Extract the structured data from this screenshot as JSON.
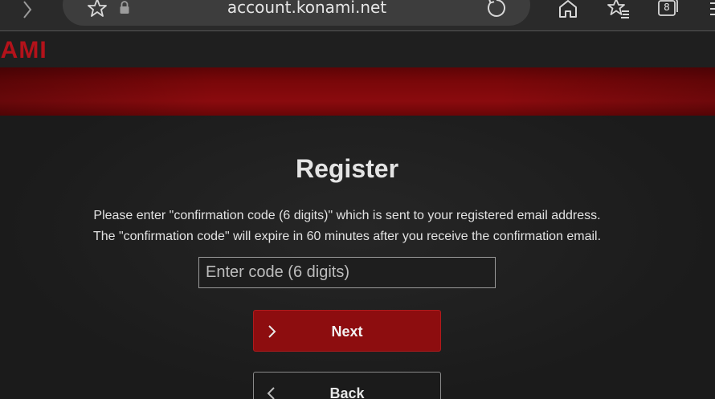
{
  "browser": {
    "url": "account.konami.net",
    "tab_count": "8",
    "icons": [
      "forward-icon",
      "star-icon",
      "lock-icon",
      "reload-icon",
      "home-icon",
      "favorites-icon",
      "tabs-icon",
      "menu-icon"
    ]
  },
  "site": {
    "logo_text": "NAMI",
    "brand_color": "#b3121a",
    "band_color": "#7a0709"
  },
  "main": {
    "title": "Register",
    "instruction_line1": "Please enter \"confirmation code (6 digits)\" which is sent to your registered email address.",
    "instruction_line2": "The \"confirmation code\" will expire in 60 minutes after you receive the confirmation email.",
    "code_input": {
      "value": "",
      "placeholder": "Enter code (6 digits)"
    },
    "next_label": "Next",
    "back_label": "Back"
  }
}
